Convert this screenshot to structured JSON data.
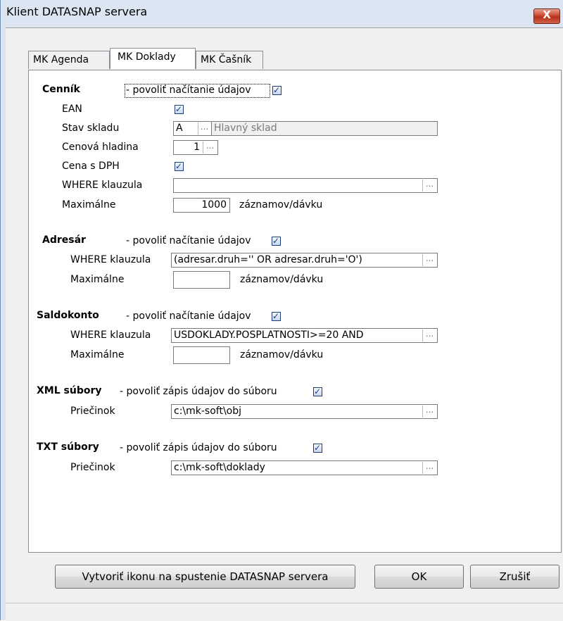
{
  "window": {
    "title": "Klient DATASNAP servera",
    "close_label": "X"
  },
  "tabs": [
    {
      "label": "MK Agenda",
      "active": false
    },
    {
      "label": "MK Doklady",
      "active": true
    },
    {
      "label": "MK Čašník",
      "active": false
    }
  ],
  "cennik": {
    "title": "Cenník",
    "enable_label": "- povoliť načítanie údajov",
    "enabled": true,
    "ean_label": "EAN",
    "ean_checked": true,
    "stav_label": "Stav skladu",
    "stav_code": "A",
    "stav_name": "Hlavný sklad",
    "cenova_label": "Cenová hladina",
    "cenova_value": "1",
    "cena_dph_label": "Cena s DPH",
    "cena_dph_checked": true,
    "where_label": "WHERE klauzula",
    "where_value": "",
    "max_label": "Maximálne",
    "max_value": "1000",
    "unit_label": "záznamov/dávku"
  },
  "adresar": {
    "title": "Adresár",
    "enable_label": "- povoliť načítanie údajov",
    "enabled": true,
    "where_label": "WHERE klauzula",
    "where_value": "(adresar.druh='' OR adresar.druh='O')",
    "max_label": "Maximálne",
    "max_value": "",
    "unit_label": "záznamov/dávku"
  },
  "saldokonto": {
    "title": "Saldokonto",
    "enable_label": "- povoliť načítanie údajov",
    "enabled": true,
    "where_label": "WHERE klauzula",
    "where_value": "USDOKLADY.POSPLATNOSTI>=20 AND",
    "max_label": "Maximálne",
    "max_value": "",
    "unit_label": "záznamov/dávku"
  },
  "xml": {
    "title": "XML súbory",
    "enable_label": "- povoliť zápis údajov do súboru",
    "enabled": true,
    "folder_label": "Priečinok",
    "folder_value": "c:\\mk-soft\\obj"
  },
  "txt": {
    "title": "TXT súbory",
    "enable_label": "- povoliť zápis údajov do súboru",
    "enabled": true,
    "folder_label": "Priečinok",
    "folder_value": "c:\\mk-soft\\doklady"
  },
  "buttons": {
    "create_icon": "Vytvoriť ikonu na spustenie DATASNAP servera",
    "ok": "OK",
    "cancel": "Zrušiť"
  },
  "ellipsis": "...",
  "check_glyph": "✓"
}
